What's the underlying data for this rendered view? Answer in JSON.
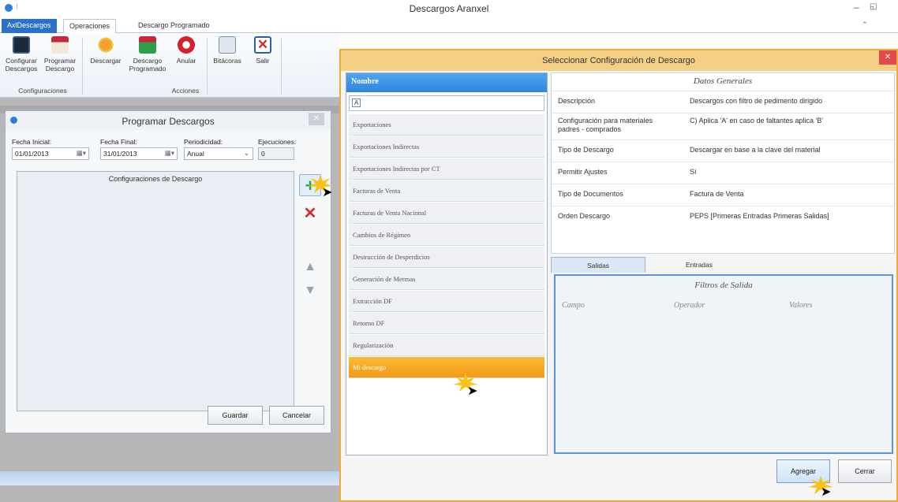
{
  "app": {
    "title": "Descargos Aranxel",
    "file_tab": "AxlDescargos",
    "tabs": [
      "Operaciones",
      "Descargo Programado"
    ]
  },
  "ribbon": {
    "buttons": [
      {
        "label": "Configurar\nDescargos",
        "icon": "monitor-icon"
      },
      {
        "label": "Programar\nDescargo",
        "icon": "calendar-icon"
      },
      {
        "label": "Descargar",
        "icon": "gear-icon"
      },
      {
        "label": "Descargo\nProgramado",
        "icon": "calendar-arrow-icon"
      },
      {
        "label": "Anular",
        "icon": "undo-icon"
      },
      {
        "label": "Bitácoras",
        "icon": "log-icon"
      },
      {
        "label": "Salir",
        "icon": "exit-icon"
      }
    ],
    "groups": [
      "Configuraciones",
      "Acciones"
    ]
  },
  "programar": {
    "title": "Programar Descargos",
    "fecha_inicial_label": "Fecha Inicial:",
    "fecha_inicial": "01/01/2013",
    "fecha_final_label": "Fecha Final:",
    "fecha_final": "31/01/2013",
    "periodicidad_label": "Periodicidad:",
    "periodicidad": "Anual",
    "ejecuciones_label": "Ejecuciones:",
    "ejecuciones": "0",
    "list_header": "Configuraciones de Descargo",
    "guardar": "Guardar",
    "cancelar": "Cancelar"
  },
  "seleccionar": {
    "title": "Seleccionar Configuración de Descargo",
    "names_header": "Nombre",
    "filter_value": "A",
    "items": [
      "Exportaciones",
      "Exportaciones Indirectas",
      "Exportaciones Indirectas por CT",
      "Facturas de Venta",
      "Facturas de Venta Nacional",
      "Cambios de Régimen",
      "Destrucción de Desperdicios",
      "Generación de Mermas",
      "Extracción DF",
      "Retorno DF",
      "Regularización",
      "Mi descargo"
    ],
    "selected_index": 11,
    "datos_header": "Datos Generales",
    "datos": [
      {
        "k": "Descripción",
        "v": "Descargos con filtro de pedimento dirigido"
      },
      {
        "k": "Configuración para materiales padres - comprados",
        "v": "C) Aplica 'A' en caso de faltantes aplica 'B'"
      },
      {
        "k": "Tipo de Descargo",
        "v": "Descargar en base a la clave del material"
      },
      {
        "k": "Permitir Ajustes",
        "v": "Sí"
      },
      {
        "k": "Tipo de Documentos",
        "v": "Factura de Venta"
      },
      {
        "k": "Orden Descargo",
        "v": "PEPS [Primeras Entradas Primeras Salidas]"
      }
    ],
    "tab_salidas": "Salidas",
    "tab_entradas": "Entradas",
    "filtros_header": "Filtros de Salida",
    "filtros_cols": [
      "Campo",
      "Operador",
      "Valores"
    ],
    "agregar": "Agregar",
    "cerrar": "Cerrar"
  }
}
